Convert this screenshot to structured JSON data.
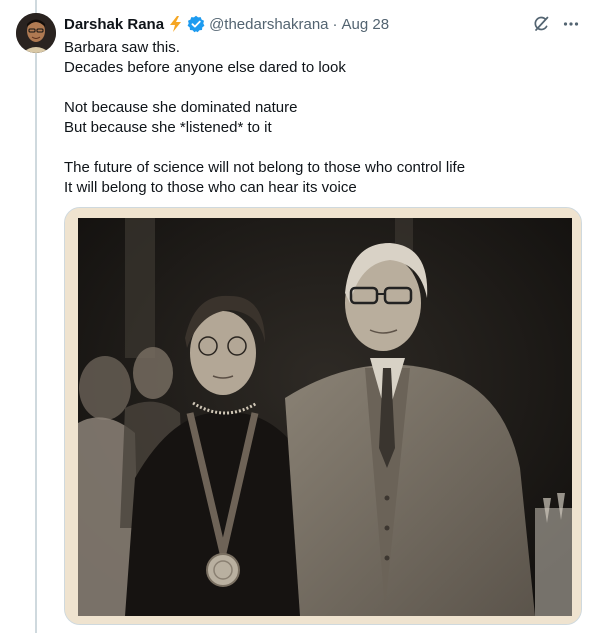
{
  "author": {
    "display_name": "Darshak Rana",
    "badge_emoji": "⚡",
    "handle": "@thedarshakrana",
    "separator": "·",
    "date": "Aug 28"
  },
  "icons": {
    "avatar": "avatar-photo",
    "bolt": "lightning-bolt-icon",
    "verified": "verified-badge-icon",
    "grok": "grok-icon",
    "more": "more-icon"
  },
  "tweet": {
    "lines": [
      "Barbara saw this.",
      "Decades before anyone else dared to look",
      "",
      "Not because she dominated nature",
      "But because she *listened* to it",
      "",
      "The future of science will not belong to those who control life",
      "It will belong to those who can hear its voice"
    ]
  },
  "colors": {
    "text": "#0f1419",
    "muted": "#536471",
    "verified": "#1d9bf0",
    "bolt": "#f5a623",
    "border": "#cfd9de"
  }
}
